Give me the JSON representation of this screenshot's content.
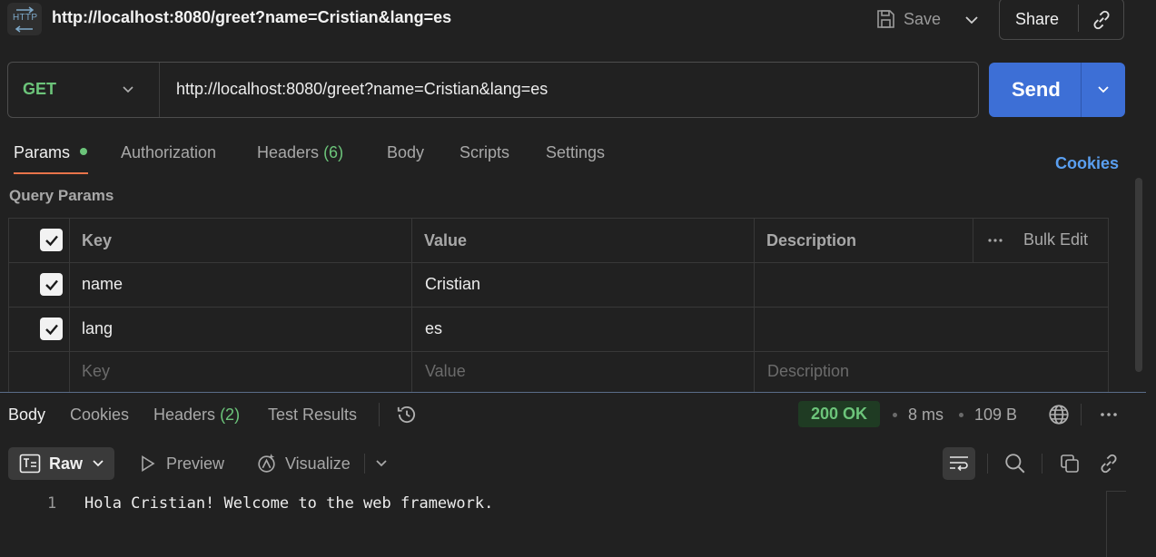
{
  "header": {
    "request_title": "http://localhost:8080/greet?name=Cristian&lang=es",
    "http_icon_text": "HTTP",
    "save_label": "Save",
    "share_label": "Share"
  },
  "request": {
    "method": "GET",
    "url": "http://localhost:8080/greet?name=Cristian&lang=es",
    "send_label": "Send"
  },
  "request_tabs": {
    "params": "Params",
    "authorization": "Authorization",
    "headers": "Headers",
    "headers_count": "(6)",
    "body": "Body",
    "scripts": "Scripts",
    "settings": "Settings",
    "active": "Params"
  },
  "cookies_label": "Cookies",
  "query_params": {
    "title": "Query Params",
    "columns": {
      "key": "Key",
      "value": "Value",
      "description": "Description"
    },
    "bulk_edit": "Bulk Edit",
    "rows": [
      {
        "checked": true,
        "key": "name",
        "value": "Cristian",
        "description": ""
      },
      {
        "checked": true,
        "key": "lang",
        "value": "es",
        "description": ""
      }
    ],
    "placeholders": {
      "key": "Key",
      "value": "Value",
      "description": "Description"
    }
  },
  "response_tabs": {
    "body": "Body",
    "cookies": "Cookies",
    "headers": "Headers",
    "headers_count": "(2)",
    "test_results": "Test Results",
    "active": "Body"
  },
  "response_meta": {
    "status": "200 OK",
    "time": "8 ms",
    "size": "109 B"
  },
  "response_toolbar": {
    "format": "Raw",
    "preview": "Preview",
    "visualize": "Visualize"
  },
  "response_body": {
    "lines": [
      {
        "number": "1",
        "text": "Hola Cristian! Welcome to the web framework."
      }
    ]
  },
  "colors": {
    "background": "#212121",
    "accent_send": "#3d6fd6",
    "method_green": "#6cc47a",
    "active_tab_underline": "#e8744a",
    "cookies_link": "#5a9ff0"
  }
}
